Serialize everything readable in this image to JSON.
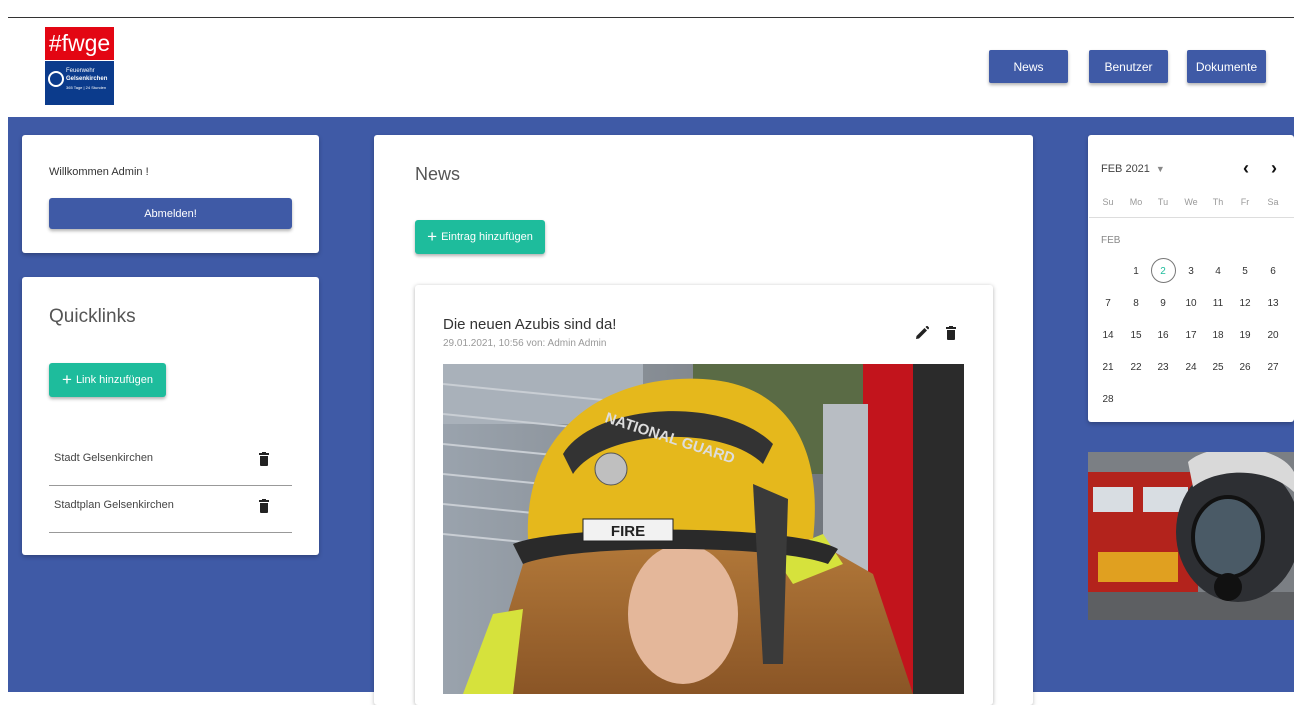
{
  "logo": {
    "tag": "#fwge",
    "line1": "Feuerwehr",
    "line2": "Gelsenkirchen",
    "line3": "365 Tage | 24 Stunden"
  },
  "nav": {
    "news": "News",
    "users": "Benutzer",
    "documents": "Dokumente"
  },
  "welcome": {
    "text": "Willkommen Admin !",
    "logout": "Abmelden!"
  },
  "quicklinks": {
    "title": "Quicklinks",
    "add_label": "Link hinzufügen",
    "items": [
      {
        "label": "Stadt Gelsenkirchen"
      },
      {
        "label": "Stadtplan Gelsenkirchen"
      }
    ]
  },
  "news": {
    "title": "News",
    "add_label": "Eintrag hinzufügen",
    "post": {
      "title": "Die neuen Azubis sind da!",
      "meta": "29.01.2021, 10:56 von: Admin Admin",
      "helmet_text": "NATIONAL GUARD",
      "badge_text": "FIRE"
    }
  },
  "calendar": {
    "month_label": "FEB 2021",
    "month_short": "FEB",
    "weekdays": [
      "Su",
      "Mo",
      "Tu",
      "We",
      "Th",
      "Fr",
      "Sa"
    ],
    "today": "2",
    "weeks": [
      [
        "",
        "1",
        "2",
        "3",
        "4",
        "5",
        "6"
      ],
      [
        "7",
        "8",
        "9",
        "10",
        "11",
        "12",
        "13"
      ],
      [
        "14",
        "15",
        "16",
        "17",
        "18",
        "19",
        "20"
      ],
      [
        "21",
        "22",
        "23",
        "24",
        "25",
        "26",
        "27"
      ],
      [
        "28",
        "",
        "",
        "",
        "",
        "",
        ""
      ]
    ]
  },
  "colors": {
    "primary": "#3f5aa6",
    "accent": "#1ebc9c",
    "logo_red": "#e30613",
    "logo_blue": "#0b3b8c"
  }
}
